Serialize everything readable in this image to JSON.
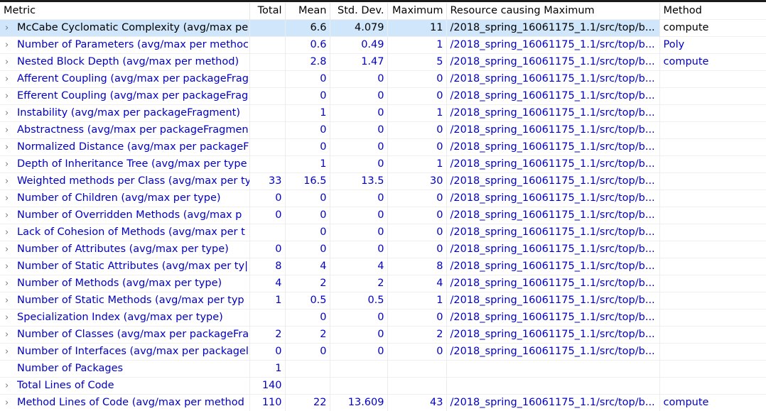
{
  "columns": {
    "metric": "Metric",
    "total": "Total",
    "mean": "Mean",
    "std_dev": "Std. Dev.",
    "maximum": "Maximum",
    "resource": "Resource causing Maximum",
    "method": "Method"
  },
  "rows": [
    {
      "metric": "McCabe Cyclomatic Complexity (avg/max pe",
      "total": "",
      "mean": "6.6",
      "std_dev": "4.079",
      "maximum": "11",
      "resource": "/2018_spring_16061175_1.1/src/top/b...",
      "method": "compute",
      "expandable": true,
      "selected": true
    },
    {
      "metric": "Number of Parameters (avg/max per methoc",
      "total": "",
      "mean": "0.6",
      "std_dev": "0.49",
      "maximum": "1",
      "resource": "/2018_spring_16061175_1.1/src/top/b...",
      "method": "Poly",
      "expandable": true
    },
    {
      "metric": "Nested Block Depth (avg/max per method)",
      "total": "",
      "mean": "2.8",
      "std_dev": "1.47",
      "maximum": "5",
      "resource": "/2018_spring_16061175_1.1/src/top/b...",
      "method": "compute",
      "expandable": true
    },
    {
      "metric": "Afferent Coupling (avg/max per packageFrag",
      "total": "",
      "mean": "0",
      "std_dev": "0",
      "maximum": "0",
      "resource": "/2018_spring_16061175_1.1/src/top/b...",
      "method": "",
      "expandable": true
    },
    {
      "metric": "Efferent Coupling (avg/max per packageFrag",
      "total": "",
      "mean": "0",
      "std_dev": "0",
      "maximum": "0",
      "resource": "/2018_spring_16061175_1.1/src/top/b...",
      "method": "",
      "expandable": true
    },
    {
      "metric": "Instability (avg/max per packageFragment)",
      "total": "",
      "mean": "1",
      "std_dev": "0",
      "maximum": "1",
      "resource": "/2018_spring_16061175_1.1/src/top/b...",
      "method": "",
      "expandable": true
    },
    {
      "metric": "Abstractness (avg/max per packageFragmen",
      "total": "",
      "mean": "0",
      "std_dev": "0",
      "maximum": "0",
      "resource": "/2018_spring_16061175_1.1/src/top/b...",
      "method": "",
      "expandable": true
    },
    {
      "metric": "Normalized Distance (avg/max per packageF",
      "total": "",
      "mean": "0",
      "std_dev": "0",
      "maximum": "0",
      "resource": "/2018_spring_16061175_1.1/src/top/b...",
      "method": "",
      "expandable": true
    },
    {
      "metric": "Depth of Inheritance Tree (avg/max per type",
      "total": "",
      "mean": "1",
      "std_dev": "0",
      "maximum": "1",
      "resource": "/2018_spring_16061175_1.1/src/top/b...",
      "method": "",
      "expandable": true
    },
    {
      "metric": "Weighted methods per Class (avg/max per ty",
      "total": "33",
      "mean": "16.5",
      "std_dev": "13.5",
      "maximum": "30",
      "resource": "/2018_spring_16061175_1.1/src/top/b...",
      "method": "",
      "expandable": true
    },
    {
      "metric": "Number of Children (avg/max per type)",
      "total": "0",
      "mean": "0",
      "std_dev": "0",
      "maximum": "0",
      "resource": "/2018_spring_16061175_1.1/src/top/b...",
      "method": "",
      "expandable": true
    },
    {
      "metric": "Number of Overridden Methods (avg/max p",
      "total": "0",
      "mean": "0",
      "std_dev": "0",
      "maximum": "0",
      "resource": "/2018_spring_16061175_1.1/src/top/b...",
      "method": "",
      "expandable": true
    },
    {
      "metric": "Lack of Cohesion of Methods (avg/max per t",
      "total": "",
      "mean": "0",
      "std_dev": "0",
      "maximum": "0",
      "resource": "/2018_spring_16061175_1.1/src/top/b...",
      "method": "",
      "expandable": true
    },
    {
      "metric": "Number of Attributes (avg/max per type)",
      "total": "0",
      "mean": "0",
      "std_dev": "0",
      "maximum": "0",
      "resource": "/2018_spring_16061175_1.1/src/top/b...",
      "method": "",
      "expandable": true
    },
    {
      "metric": "Number of Static Attributes (avg/max per ty|",
      "total": "8",
      "mean": "4",
      "std_dev": "4",
      "maximum": "8",
      "resource": "/2018_spring_16061175_1.1/src/top/b...",
      "method": "",
      "expandable": true
    },
    {
      "metric": "Number of Methods (avg/max per type)",
      "total": "4",
      "mean": "2",
      "std_dev": "2",
      "maximum": "4",
      "resource": "/2018_spring_16061175_1.1/src/top/b...",
      "method": "",
      "expandable": true
    },
    {
      "metric": "Number of Static Methods (avg/max per typ",
      "total": "1",
      "mean": "0.5",
      "std_dev": "0.5",
      "maximum": "1",
      "resource": "/2018_spring_16061175_1.1/src/top/b...",
      "method": "",
      "expandable": true
    },
    {
      "metric": "Specialization Index (avg/max per type)",
      "total": "",
      "mean": "0",
      "std_dev": "0",
      "maximum": "0",
      "resource": "/2018_spring_16061175_1.1/src/top/b...",
      "method": "",
      "expandable": true
    },
    {
      "metric": "Number of Classes (avg/max per packageFra",
      "total": "2",
      "mean": "2",
      "std_dev": "0",
      "maximum": "2",
      "resource": "/2018_spring_16061175_1.1/src/top/b...",
      "method": "",
      "expandable": true
    },
    {
      "metric": "Number of Interfaces (avg/max per packagel",
      "total": "0",
      "mean": "0",
      "std_dev": "0",
      "maximum": "0",
      "resource": "/2018_spring_16061175_1.1/src/top/b...",
      "method": "",
      "expandable": true
    },
    {
      "metric": "Number of Packages",
      "total": "1",
      "mean": "",
      "std_dev": "",
      "maximum": "",
      "resource": "",
      "method": "",
      "expandable": false
    },
    {
      "metric": "Total Lines of Code",
      "total": "140",
      "mean": "",
      "std_dev": "",
      "maximum": "",
      "resource": "",
      "method": "",
      "expandable": true
    },
    {
      "metric": "Method Lines of Code (avg/max per method",
      "total": "110",
      "mean": "22",
      "std_dev": "13.609",
      "maximum": "43",
      "resource": "/2018_spring_16061175_1.1/src/top/b...",
      "method": "compute",
      "expandable": true
    }
  ],
  "icons": {
    "expand": "chevron-right-icon",
    "expand_glyph": "›"
  },
  "colors": {
    "selected_row": "#cfe6fb",
    "link_text": "#0000c8",
    "header_text": "#000000"
  }
}
